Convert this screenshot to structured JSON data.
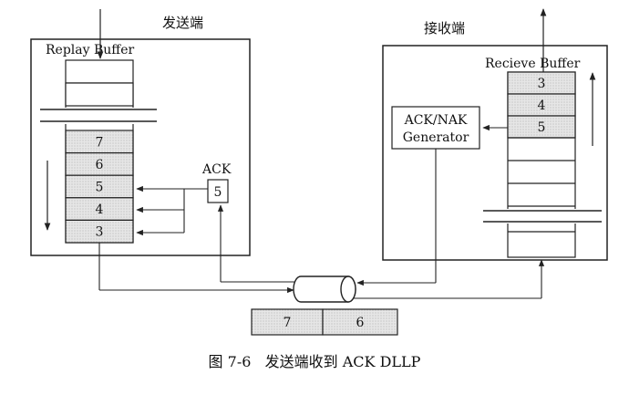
{
  "sender": {
    "title": "发送端",
    "buffer_label": "Replay Buffer",
    "slots": [
      "7",
      "6",
      "5",
      "4",
      "3"
    ],
    "ack_label": "ACK",
    "ack_value": "5"
  },
  "receiver": {
    "title": "接收端",
    "buffer_label": "Recieve Buffer",
    "slots": [
      "3",
      "4",
      "5"
    ],
    "generator_line1": "ACK/NAK",
    "generator_line2": "Generator"
  },
  "link": {
    "packets": [
      "7",
      "6"
    ]
  },
  "caption": "图 7-6   发送端收到 ACK DLLP"
}
